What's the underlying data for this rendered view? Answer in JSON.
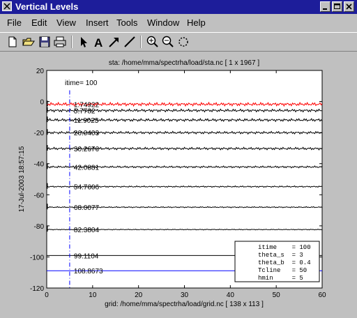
{
  "window": {
    "title": "Vertical Levels"
  },
  "menu": [
    "File",
    "Edit",
    "View",
    "Insert",
    "Tools",
    "Window",
    "Help"
  ],
  "toolbar_icons": [
    "new-file-icon",
    "open-folder-icon",
    "save-icon",
    "print-icon",
    "select-arrow-icon",
    "insert-text-icon",
    "insert-arrow-icon",
    "insert-line-icon",
    "zoom-in-icon",
    "zoom-out-icon",
    "rotate-icon"
  ],
  "chart_data": {
    "type": "line",
    "title": "sta: /home/mma/spectrha/load/sta.nc  [ 1 x 1967 ]",
    "xlabel": "grid: /home/mma/spectrha/load/grid.nc  [ 138 x 113 ]",
    "ylabel": "17-Jul-2003 18:57:15",
    "xlim": [
      0,
      60
    ],
    "ylim": [
      -120,
      20
    ],
    "xticks": [
      "0",
      "10",
      "20",
      "30",
      "40",
      "50",
      "60"
    ],
    "yticks": [
      "20",
      "0",
      "-20",
      "-40",
      "-60",
      "-80",
      "-100",
      "-120"
    ],
    "itime_label": "itime= 100",
    "marker_x": 5,
    "levels": [
      {
        "depth": -1.74922,
        "label": "1.74922",
        "color": "#ff0000",
        "amp": 1.2
      },
      {
        "depth": -5.7782,
        "label": "5.7782",
        "color": "#000000",
        "amp": 1.0
      },
      {
        "depth": -11.9023,
        "label": "11.9023",
        "color": "#000000",
        "amp": 1.0
      },
      {
        "depth": -20.0403,
        "label": "20.0403",
        "color": "#000000",
        "amp": 0.9
      },
      {
        "depth": -30.2676,
        "label": "30.2676",
        "color": "#000000",
        "amp": 0.9
      },
      {
        "depth": -42.0881,
        "label": "42.0881",
        "color": "#000000",
        "amp": 0.7
      },
      {
        "depth": -54.7606,
        "label": "54.7606",
        "color": "#000000",
        "amp": 0.5
      },
      {
        "depth": -68.0077,
        "label": "68.0077",
        "color": "#000000",
        "amp": 0.4
      },
      {
        "depth": -82.3804,
        "label": "82.3804",
        "color": "#000000",
        "amp": 0.3
      },
      {
        "depth": -99.1104,
        "label": "99.1104",
        "color": "#000000",
        "amp": 0.0
      },
      {
        "depth": -108.8673,
        "label": "108.8673",
        "color": "#0000ff",
        "amp": 0.0
      }
    ],
    "info_box": [
      "itime    = 100",
      "theta_s  = 3",
      "theta_b  = 0.4",
      "Tcline   = 50",
      "hmin     = 5"
    ]
  }
}
